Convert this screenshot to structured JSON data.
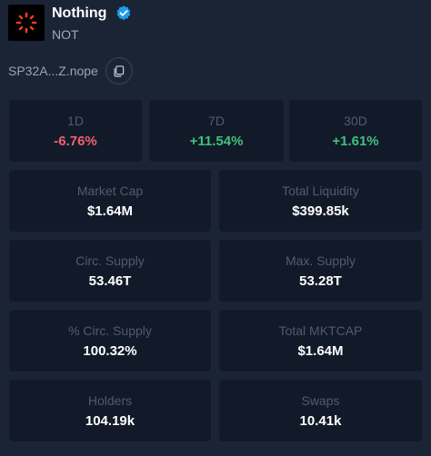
{
  "token": {
    "name": "Nothing",
    "symbol": "NOT",
    "verified_icon": "verified-badge-icon",
    "logo_icon": "nothing-logo-icon",
    "address": "SP32A...Z.nope",
    "copy_icon": "copy-icon"
  },
  "changes": [
    {
      "label": "1D",
      "value": "-6.76%"
    },
    {
      "label": "7D",
      "value": "+11.54%"
    },
    {
      "label": "30D",
      "value": "+1.61%"
    }
  ],
  "stats": [
    {
      "label": "Market Cap",
      "value": "$1.64M"
    },
    {
      "label": "Total Liquidity",
      "value": "$399.85k"
    },
    {
      "label": "Circ. Supply",
      "value": "53.46T"
    },
    {
      "label": "Max. Supply",
      "value": "53.28T"
    },
    {
      "label": "% Circ. Supply",
      "value": "100.32%"
    },
    {
      "label": "Total MKTCAP",
      "value": "$1.64M"
    },
    {
      "label": "Holders",
      "value": "104.19k"
    },
    {
      "label": "Swaps",
      "value": "10.41k"
    }
  ],
  "colors": {
    "background": "#1b2435",
    "card": "#121a29",
    "negative": "#f0606b",
    "positive": "#3ec27a",
    "verified": "#1d9bf0",
    "logo_accent": "#e8401c"
  }
}
